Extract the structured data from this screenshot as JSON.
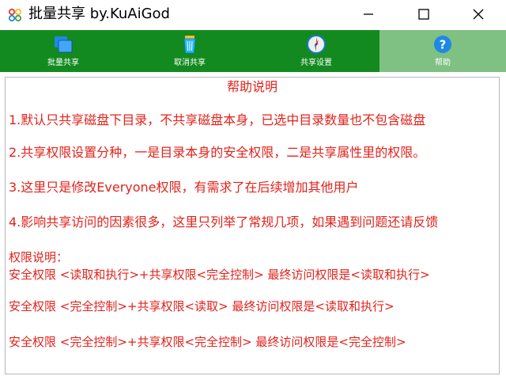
{
  "window": {
    "title": "批量共享 by.KuAiGod",
    "icons": {
      "app": "app-logo-icon",
      "minimize": "minimize-icon",
      "maximize": "maximize-icon",
      "close": "close-icon"
    }
  },
  "toolbar": {
    "background": "#138a1f",
    "active_background": "#7fc083",
    "items": [
      {
        "label": "批量共享",
        "icon": "folders-icon"
      },
      {
        "label": "取消共享",
        "icon": "trash-icon"
      },
      {
        "label": "共享设置",
        "icon": "compass-icon"
      },
      {
        "label": "帮助",
        "icon": "help-icon",
        "active": true
      }
    ]
  },
  "help": {
    "title": "帮助说明",
    "text_color": "#e0231c",
    "lines": [
      "1.默认只共享磁盘下目录，不共享磁盘本身，已选中目录数量也不包含磁盘",
      "2.共享权限设置分种，一是目录本身的安全权限，二是共享属性里的权限。",
      "3.这里只是修改Everyone权限，有需求了在后续增加其他用户",
      "4.影响共享访问的因素很多，这里只列举了常规几项，如果遇到问题还请反馈",
      "权限说明：",
      "安全权限 <读取和执行>+共享权限<完全控制> 最终访问权限是<读取和执行>",
      "安全权限 <完全控制>+共享权限<读取> 最终访问权限是<读取和执行>",
      "安全权限 <完全控制>+共享权限<完全控制> 最终访问权限是<完全控制>"
    ]
  }
}
